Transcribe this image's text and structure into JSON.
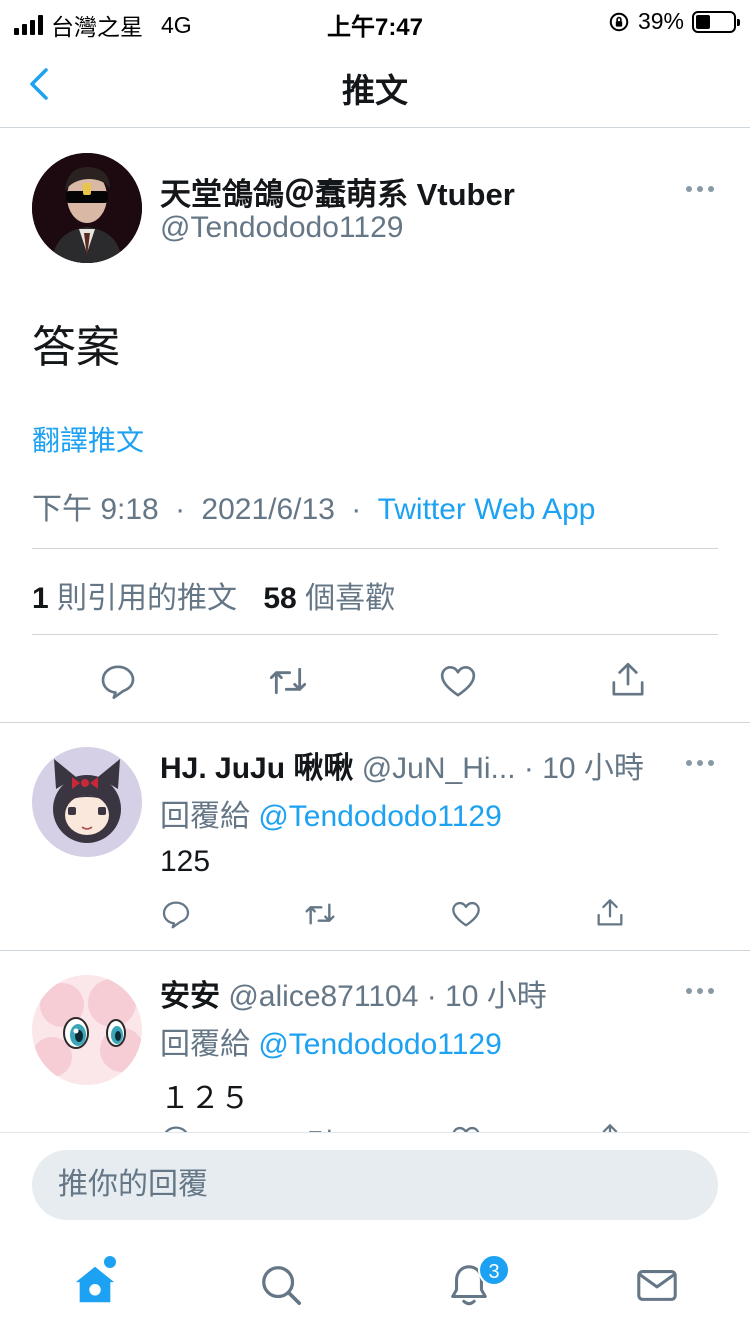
{
  "status_bar": {
    "carrier": "台灣之星",
    "network": "4G",
    "time": "上午7:47",
    "battery": "39%",
    "battery_level": 0.39
  },
  "nav": {
    "title": "推文",
    "back_icon": "chevron-left-icon"
  },
  "main_tweet": {
    "display_name": "天堂鴿鴿＠蠢萌系 Vtuber",
    "handle": "@Tendododo1129",
    "text": "答案",
    "translate_label": "翻譯推文",
    "time": "下午 9:18",
    "separator": "·",
    "date": "2021/6/13",
    "source": "Twitter Web App",
    "quote_count": "1",
    "quote_label": "則引用的推文",
    "like_count": "58",
    "like_label": "個喜歡"
  },
  "replies": [
    {
      "display_name": "HJ. JuJu 啾啾",
      "handle": "@JuN_Hi...",
      "time": "· 10 小時",
      "reply_to_label": "回覆給",
      "reply_to_handle": "@Tendododo1129",
      "text": "125"
    },
    {
      "display_name": "安安",
      "handle": "@alice871104",
      "time": "· 10 小時",
      "reply_to_label": "回覆給",
      "reply_to_handle": "@Tendododo1129",
      "text": "１２５"
    }
  ],
  "compose": {
    "placeholder": "推你的回覆"
  },
  "tabbar": {
    "notification_badge": "3"
  },
  "colors": {
    "accent": "#1da1f2",
    "text_primary": "#14171a",
    "text_secondary": "#657786",
    "divider": "#cfd6db"
  }
}
